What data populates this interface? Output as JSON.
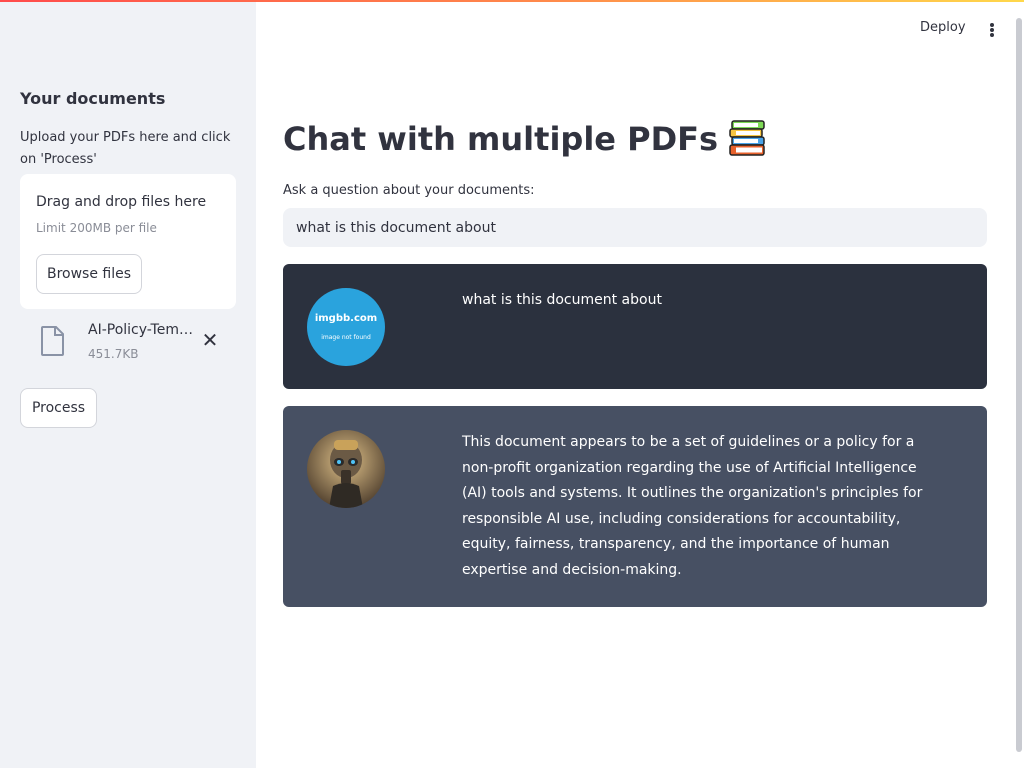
{
  "sidebar": {
    "title": "Your documents",
    "description": "Upload your PDFs here and click on 'Process'",
    "uploader": {
      "title": "Drag and drop files here",
      "limit": "Limit 200MB per file",
      "browse_label": "Browse files"
    },
    "file": {
      "name": "AI-Policy-Tem…",
      "size": "451.7KB",
      "icon": "file-icon"
    },
    "process_label": "Process"
  },
  "header": {
    "deploy_label": "Deploy"
  },
  "main": {
    "title": "Chat with multiple PDFs",
    "title_icon": "books-icon",
    "question_label": "Ask a question about your documents:",
    "question_value": "what is this document about"
  },
  "chat": {
    "user": {
      "avatar_brand": "imgbb.com",
      "avatar_note": "image not found",
      "text": "what is this document about"
    },
    "bot": {
      "avatar": "robot-avatar",
      "text": "This document appears to be a set of guidelines or a policy for a non-profit organization regarding the use of Artificial Intelligence (AI) tools and systems. It outlines the organization's principles for responsible AI use, including considerations for accountability, equity, fairness, transparency, and the importance of human expertise and decision-making."
    }
  },
  "colors": {
    "accent_gradient_start": "#ff4b4b",
    "accent_gradient_end": "#ffd84b",
    "user_bubble": "#2b313e",
    "bot_bubble": "#475063",
    "sidebar_bg": "#f0f2f6"
  }
}
